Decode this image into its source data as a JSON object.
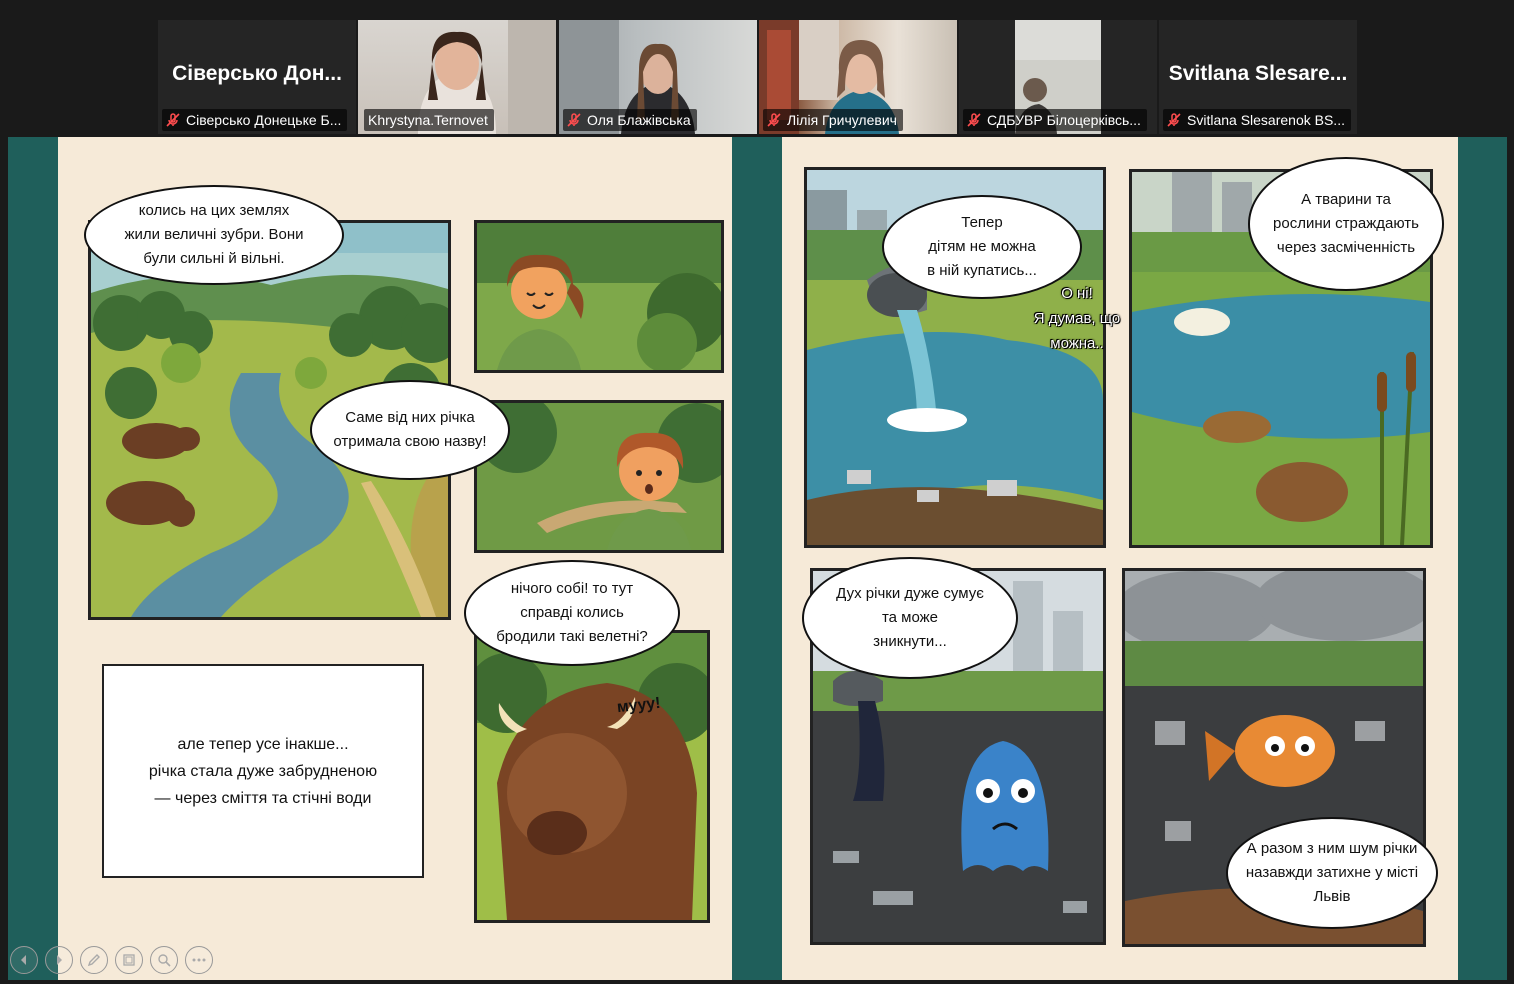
{
  "participants": [
    {
      "display": "Сіверсько Дон...",
      "label": "Сіверсько Донецьке Б...",
      "video": false,
      "muted": true,
      "active": false
    },
    {
      "display": "",
      "label": "Khrystyna.Ternovet",
      "video": true,
      "muted": false,
      "active": true
    },
    {
      "display": "",
      "label": "Оля Блажівська",
      "video": true,
      "muted": true,
      "active": false
    },
    {
      "display": "",
      "label": "Лілія Гричулевич",
      "video": true,
      "muted": true,
      "active": false
    },
    {
      "display": "",
      "label": "СДБУВР Білоцерківсь...",
      "video": true,
      "muted": true,
      "active": false
    },
    {
      "display": "Svitlana  Slesare...",
      "label": "Svitlana Slesarenok BS...",
      "video": false,
      "muted": true,
      "active": false
    }
  ],
  "comic": {
    "left": {
      "bubble1": [
        "колись на цих землях",
        "жили величні зубри. Вони",
        "були сильні й вільні."
      ],
      "bubble2": [
        "Саме від них річка",
        "отримала свою назву!"
      ],
      "bubble3": [
        "нічого собі! то тут",
        "справді  колись",
        "бродили такі велетні?"
      ],
      "caption": [
        "але тепер усе інакше...",
        "річка стала дуже забрудненою",
        "— через сміття та стічні води"
      ],
      "sfx": "мууу!"
    },
    "right": {
      "bubble1": [
        "Тепер",
        "дітям не можна",
        "в ній купатись..."
      ],
      "float": [
        "О ні!",
        "Я думав, що",
        "можна.."
      ],
      "bubble2": [
        "А тварини та",
        "рослини страждають",
        "через засміченність"
      ],
      "bubble3": [
        "Дух річки дуже сумує",
        "та може",
        "зникнути..."
      ],
      "bubble4": [
        "А разом з ним шум річки",
        "назавжди затихне у місті",
        "Львів"
      ]
    }
  },
  "colors": {
    "accent": "#2ed573",
    "page": "#f6ead8",
    "frame": "#1f5f5b"
  },
  "toolbar_icons": [
    "prev-icon",
    "next-icon",
    "pen-icon",
    "slides-icon",
    "zoom-icon",
    "more-icon"
  ]
}
